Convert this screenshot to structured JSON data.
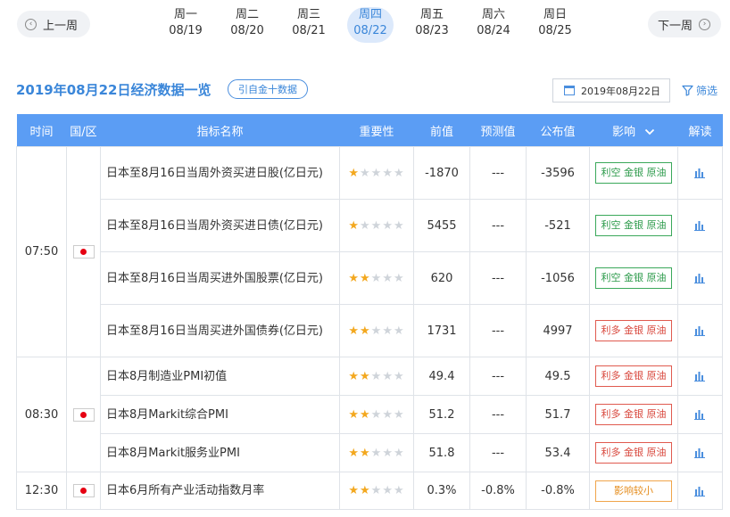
{
  "week_nav": {
    "prev_label": "上一周",
    "next_label": "下一周",
    "days": [
      {
        "weekday": "周一",
        "date": "08/19",
        "active": false
      },
      {
        "weekday": "周二",
        "date": "08/20",
        "active": false
      },
      {
        "weekday": "周三",
        "date": "08/21",
        "active": false
      },
      {
        "weekday": "周四",
        "date": "08/22",
        "active": true
      },
      {
        "weekday": "周五",
        "date": "08/23",
        "active": false
      },
      {
        "weekday": "周六",
        "date": "08/24",
        "active": false
      },
      {
        "weekday": "周日",
        "date": "08/25",
        "active": false
      }
    ]
  },
  "header": {
    "title": "2019年08月22日经济数据一览",
    "source_button": "引自金十数据",
    "date_value": "2019年08月22日",
    "filter_label": "筛选"
  },
  "table": {
    "columns": [
      "时间",
      "国/区",
      "指标名称",
      "重要性",
      "前值",
      "预测值",
      "公布值",
      "影响",
      "解读"
    ],
    "groups": [
      {
        "time": "07:50",
        "flag": "japan-flag",
        "rows": [
          {
            "name": "日本至8月16日当周外资买进日股(亿日元)",
            "stars": 1,
            "prev": "-1870",
            "forecast": "---",
            "actual": "-3596",
            "impact": "利空 金银 原油",
            "impact_type": "good"
          },
          {
            "name": "日本至8月16日当周外资买进日债(亿日元)",
            "stars": 1,
            "prev": "5455",
            "forecast": "---",
            "actual": "-521",
            "impact": "利空 金银 原油",
            "impact_type": "good"
          },
          {
            "name": "日本至8月16日当周买进外国股票(亿日元)",
            "stars": 2,
            "prev": "620",
            "forecast": "---",
            "actual": "-1056",
            "impact": "利空 金银 原油",
            "impact_type": "good"
          },
          {
            "name": "日本至8月16日当周买进外国债券(亿日元)",
            "stars": 2,
            "prev": "1731",
            "forecast": "---",
            "actual": "4997",
            "impact": "利多 金银 原油",
            "impact_type": "bad"
          }
        ]
      },
      {
        "time": "08:30",
        "flag": "japan-flag",
        "rows": [
          {
            "name": "日本8月制造业PMI初值",
            "stars": 2,
            "prev": "49.4",
            "forecast": "---",
            "actual": "49.5",
            "impact": "利多 金银 原油",
            "impact_type": "bad"
          },
          {
            "name": "日本8月Markit综合PMI",
            "stars": 2,
            "prev": "51.2",
            "forecast": "---",
            "actual": "51.7",
            "impact": "利多 金银 原油",
            "impact_type": "bad"
          },
          {
            "name": "日本8月Markit服务业PMI",
            "stars": 2,
            "prev": "51.8",
            "forecast": "---",
            "actual": "53.4",
            "impact": "利多 金银 原油",
            "impact_type": "bad"
          }
        ]
      },
      {
        "time": "12:30",
        "flag": "japan-flag",
        "rows": [
          {
            "name": "日本6月所有产业活动指数月率",
            "stars": 2,
            "prev": "0.3%",
            "forecast": "-0.8%",
            "actual": "-0.8%",
            "impact": "影响较小",
            "impact_type": "neutral"
          }
        ]
      }
    ]
  },
  "colors": {
    "accent": "#3a86d9",
    "header_bg": "#5b9df4",
    "positive": "#2b9a4a",
    "negative": "#d8463b",
    "neutral": "#e58e1f",
    "star_on": "#f3a81f"
  }
}
